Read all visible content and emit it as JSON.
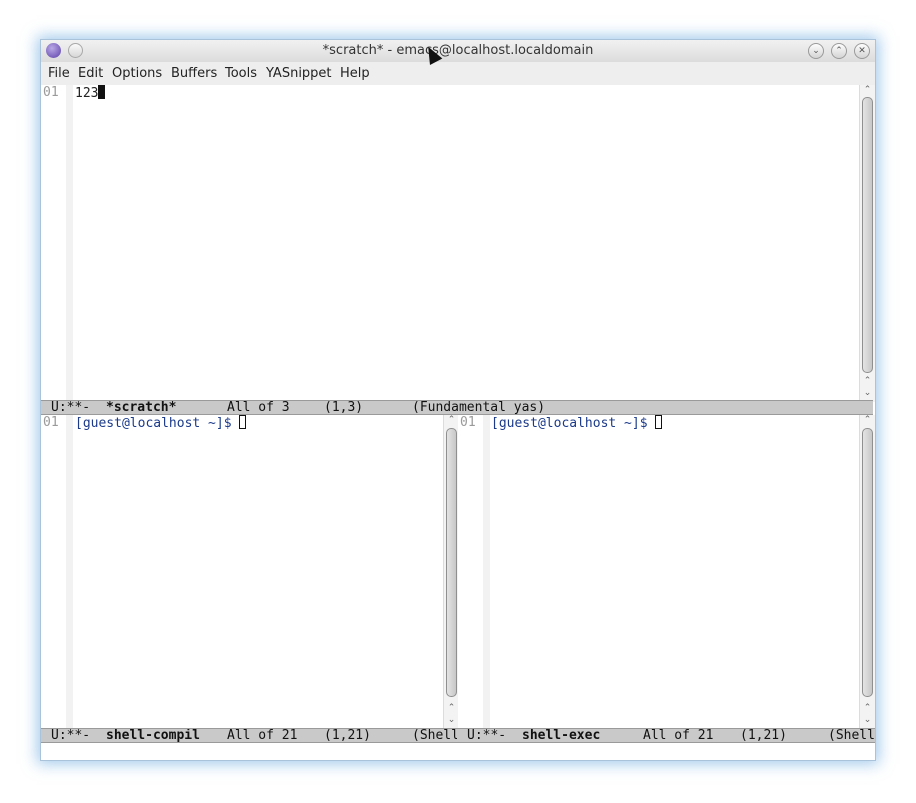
{
  "window": {
    "title": "*scratch* - emacs@localhost.localdomain"
  },
  "titlebar_icons": [
    "emacs-app-icon",
    "pin-icon",
    "minimize-icon",
    "maximize-icon",
    "close-icon"
  ],
  "menu": [
    "File",
    "Edit",
    "Options",
    "Buffers",
    "Tools",
    "YASnippet",
    "Help"
  ],
  "top_pane": {
    "line_number": "01",
    "content": "123",
    "modeline": {
      "status": "U:**-",
      "buffer": "*scratch*",
      "position": "All of 3",
      "cursor": "(1,3)",
      "mode": "(Fundamental yas)"
    }
  },
  "left_pane": {
    "line_number": "01",
    "prompt": "[guest@localhost ~]$",
    "modeline": {
      "status": "U:**-",
      "buffer": "shell-compil",
      "position": "All of 21",
      "cursor": "(1,21)",
      "mode": "(Shell"
    }
  },
  "right_pane": {
    "line_number": "01",
    "prompt": "[guest@localhost ~]$",
    "modeline": {
      "status": "U:**-",
      "buffer": "shell-exec",
      "position": "All of 21",
      "cursor": "(1,21)",
      "mode": "(Shell"
    }
  }
}
